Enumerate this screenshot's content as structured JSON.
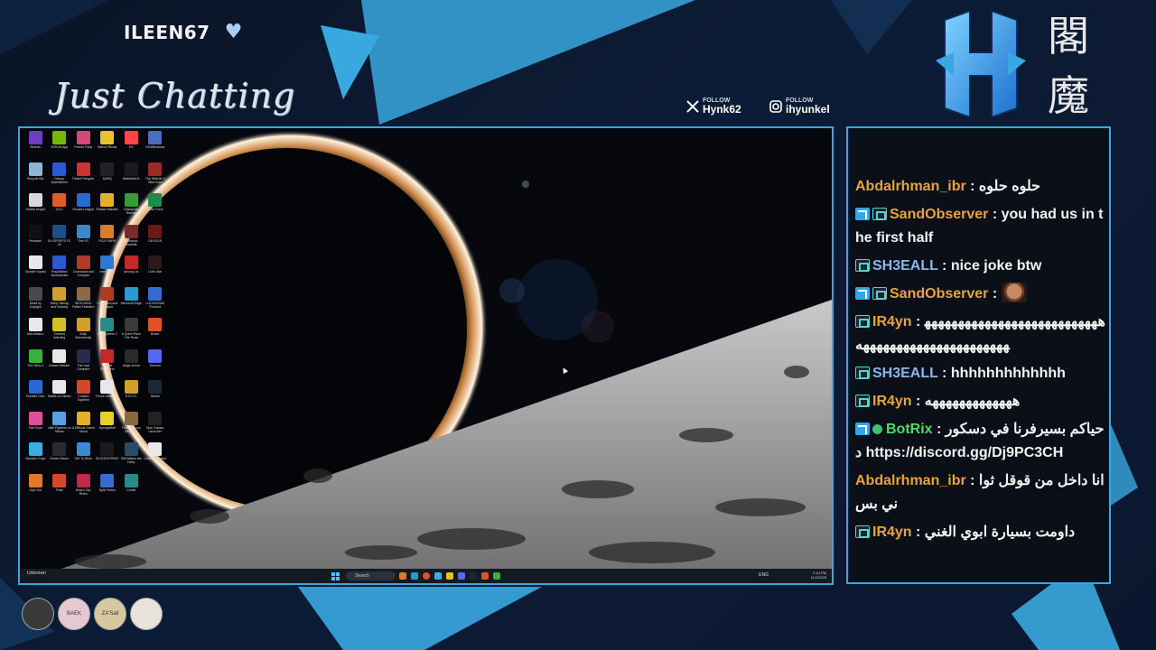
{
  "overlay": {
    "streamer_name": "ILEEN67",
    "category": "Just Chatting",
    "socials": [
      {
        "platform_icon": "x-logo-icon",
        "small": "FOLLOW",
        "name": "Hynk62"
      },
      {
        "platform_icon": "instagram-icon",
        "small": "FOLLOW",
        "name": "ihyunkel"
      }
    ],
    "logo_letter": "H",
    "kanji": [
      "閣",
      "魔"
    ],
    "colors": {
      "accent": "#3aa8e0",
      "gold": "#e8a33a",
      "sub_badge": "#57d6c7"
    }
  },
  "desktop": {
    "icons": [
      {
        "label": "Stremio",
        "color": "#6b3fc0"
      },
      {
        "label": "NVIDIA App",
        "color": "#76b900"
      },
      {
        "label": "Funnel Party",
        "color": "#d04a7a"
      },
      {
        "label": "Marvel Rivals",
        "color": "#e6c42c"
      },
      {
        "label": "EA",
        "color": "#ff4747"
      },
      {
        "label": "DS4Windows",
        "color": "#4a6fbf"
      },
      {
        "label": "Recycle Bin",
        "color": "#8fb4d6"
      },
      {
        "label": "Disney Speedstorm",
        "color": "#2a5bd0"
      },
      {
        "label": "Faded Penguin",
        "color": "#cc3333"
      },
      {
        "label": "DARQ",
        "color": "#222"
      },
      {
        "label": "Battlefield 6",
        "color": "#1a1a1a"
      },
      {
        "label": "The Witcher 3 Wild Hunt",
        "color": "#9a2a2a"
      },
      {
        "label": "Hollow Knight",
        "color": "#d8d8d8"
      },
      {
        "label": "IXCC",
        "color": "#e05a2a"
      },
      {
        "label": "Rocket League",
        "color": "#2a6ad0"
      },
      {
        "label": "Robber Bandits",
        "color": "#e0b030"
      },
      {
        "label": "Stampede Racing",
        "color": "#3a9a3a"
      },
      {
        "label": "Delta Force",
        "color": "#1f8a4a"
      },
      {
        "label": "Rematch",
        "color": "#111"
      },
      {
        "label": "EA SPORTS FC 26",
        "color": "#1b4f8a"
      },
      {
        "label": "This PC",
        "color": "#3a86d0"
      },
      {
        "label": "PICO PARK",
        "color": "#e07a2a"
      },
      {
        "label": "Buckshot Roulette",
        "color": "#7a2a2a"
      },
      {
        "label": "DEVOUR",
        "color": "#6a1a1a"
      },
      {
        "label": "Suicide Squad",
        "color": "#e8e8e8"
      },
      {
        "label": "PlayStation Accessories",
        "color": "#2a5ad0"
      },
      {
        "label": "Command and Conquer",
        "color": "#b03a2a"
      },
      {
        "label": "Intel Driver",
        "color": "#2a7ad0"
      },
      {
        "label": "Among Us",
        "color": "#c02a2a"
      },
      {
        "label": "Liar's Bar",
        "color": "#2a1a1a"
      },
      {
        "label": "Dead by Daylight",
        "color": "#4a4a4a"
      },
      {
        "label": "Keep Talking and Nobody",
        "color": "#d0a02a"
      },
      {
        "label": "WUCHANG Fallen Feathers",
        "color": "#8a6a4a"
      },
      {
        "label": "Command and Conquer",
        "color": "#b03a2a"
      },
      {
        "label": "Microsoft Edge",
        "color": "#2a9ad0"
      },
      {
        "label": "LOCKDOWN Protocol",
        "color": "#3a6ad0"
      },
      {
        "label": "MicroMacro",
        "color": "#e8e8e8"
      },
      {
        "label": "Content Warning",
        "color": "#d0c02a"
      },
      {
        "label": "Bully Scholarship",
        "color": "#d0a02a"
      },
      {
        "label": "AtmoSphere 2",
        "color": "#2a8a8a"
      },
      {
        "label": "A Quiet Place The Road",
        "color": "#3a3a3a"
      },
      {
        "label": "Brave",
        "color": "#e0502a"
      },
      {
        "label": "The Sims 4",
        "color": "#3ab03a"
      },
      {
        "label": "Instant Stream",
        "color": "#e8e8e8"
      },
      {
        "label": "The Last Campfire",
        "color": "#2a2a4a"
      },
      {
        "label": "Double Shoulders",
        "color": "#c02a2a"
      },
      {
        "label": "Mage Arena",
        "color": "#2a2a2a"
      },
      {
        "label": "Discord",
        "color": "#5865f2"
      },
      {
        "label": "Rumble Club",
        "color": "#2a6ad0"
      },
      {
        "label": "Maths on Steam",
        "color": "#e8e8e8"
      },
      {
        "label": "Cooked Together",
        "color": "#d04a2a"
      },
      {
        "label": "Forza Horizon 5",
        "color": "#e8e8e8"
      },
      {
        "label": "R.E.P.O.",
        "color": "#d0a02a"
      },
      {
        "label": "Steam",
        "color": "#1b2838"
      },
      {
        "label": "Fall Guys",
        "color": "#e0509a"
      },
      {
        "label": "Little Fighters on Steam",
        "color": "#5aa0e0"
      },
      {
        "label": "A Difficult Game About",
        "color": "#e0b02a"
      },
      {
        "label": "SpongeBob",
        "color": "#e8d02a"
      },
      {
        "label": "That's not my Neighbor",
        "color": "#8a6a3a"
      },
      {
        "label": "Epic Games Launcher",
        "color": "#222"
      },
      {
        "label": "Stumble Guys",
        "color": "#3ab0e0"
      },
      {
        "label": "Dream Racer",
        "color": "#2a2a2a"
      },
      {
        "label": "Get To Work",
        "color": "#3a8ad0"
      },
      {
        "label": "BLOODSTRIKE",
        "color": "#1a1a1a"
      },
      {
        "label": "Still Wakes the Deep",
        "color": "#2a4a6a"
      },
      {
        "label": "Ubisoft Connect",
        "color": "#e8e8e8"
      },
      {
        "label": "Spin Out",
        "color": "#e07a2a"
      },
      {
        "label": "Peak",
        "color": "#d04a2a"
      },
      {
        "label": "Board Sky Rules",
        "color": "#c02a4a"
      },
      {
        "label": "Split Fiction",
        "color": "#3a6ad0"
      },
      {
        "label": "Comet",
        "color": "#2a8a8a"
      }
    ],
    "taskbar": {
      "weather": "Unknown",
      "search_placeholder": "Search",
      "clock_time": "2:10 PM",
      "clock_date": "11/2/2025",
      "lang": "ENG"
    }
  },
  "chat": {
    "messages": [
      {
        "badges": [],
        "user": "Abdalrhman_ibr",
        "user_color": "#e8a33a",
        "text": "حلوه حلوه",
        "rtl": true
      },
      {
        "badges": [
          "mod",
          "sub"
        ],
        "user": "SandObserver",
        "user_color": "#e8a33a",
        "text": "you had us in the first half",
        "rtl": false
      },
      {
        "badges": [
          "sub"
        ],
        "user": "SH3EALL",
        "user_color": "#8ab8e8",
        "text": "nice joke btw",
        "rtl": false
      },
      {
        "badges": [
          "mod",
          "sub"
        ],
        "user": "SandObserver",
        "user_color": "#e8a33a",
        "text": "",
        "emote": "face-emote",
        "rtl": false
      },
      {
        "badges": [
          "sub"
        ],
        "user": "IR4yn",
        "user_color": "#e8a33a",
        "text": "هههههههههههههههههههههههههههههههههههههههههههههههههه",
        "rtl": false
      },
      {
        "badges": [
          "sub"
        ],
        "user": "SH3EALL",
        "user_color": "#8ab8e8",
        "text": "hhhhhhhhhhhhh",
        "rtl": false
      },
      {
        "badges": [
          "sub"
        ],
        "user": "IR4yn",
        "user_color": "#e8a33a",
        "text": "هههههههههههههه",
        "rtl": false
      },
      {
        "badges": [
          "mod",
          "verified"
        ],
        "user": "BotRix",
        "user_color": "#57d66b",
        "text": "حياكم بسيرفرنا في دسكورد https://discord.gg/Dj9PC3CH",
        "rtl": false
      },
      {
        "badges": [],
        "user": "Abdalrhman_ibr",
        "user_color": "#e8a33a",
        "text": "انا داخل من قوقل ثواني بس",
        "rtl": false
      },
      {
        "badges": [
          "sub"
        ],
        "user": "IR4yn",
        "user_color": "#e8a33a",
        "text": "داومت بسيارة ابوي الغني",
        "rtl": false
      }
    ]
  },
  "supporters": [
    {
      "label": "",
      "color": "#3a3a3a"
    },
    {
      "label": "BAEK",
      "color": "#e8c8d0"
    },
    {
      "label": "ZA'Sall",
      "color": "#d8c8a0"
    },
    {
      "label": "",
      "color": "#e8e4dc"
    }
  ]
}
